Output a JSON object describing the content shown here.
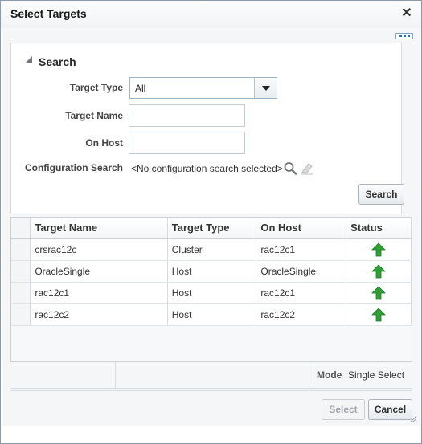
{
  "dialog": {
    "title": "Select Targets",
    "close_symbol": "✕"
  },
  "search": {
    "header": "Search",
    "target_type_label": "Target Type",
    "target_type_value": "All",
    "target_name_label": "Target Name",
    "target_name_value": "",
    "on_host_label": "On Host",
    "on_host_value": "",
    "config_search_label": "Configuration Search",
    "config_search_value": "<No configuration search selected>",
    "search_button": "Search"
  },
  "table": {
    "columns": [
      "Target Name",
      "Target Type",
      "On Host",
      "Status"
    ],
    "rows": [
      {
        "target_name": "crsrac12c",
        "target_type": "Cluster",
        "on_host": "rac12c1",
        "status": "up"
      },
      {
        "target_name": "OracleSingle",
        "target_type": "Host",
        "on_host": "OracleSingle",
        "status": "up"
      },
      {
        "target_name": "rac12c1",
        "target_type": "Host",
        "on_host": "rac12c1",
        "status": "up"
      },
      {
        "target_name": "rac12c2",
        "target_type": "Host",
        "on_host": "rac12c2",
        "status": "up"
      }
    ]
  },
  "footer": {
    "mode_label": "Mode",
    "mode_value": "Single Select",
    "select_button": "Select",
    "cancel_button": "Cancel"
  },
  "colors": {
    "status_up": "#2f9e35",
    "accent_border": "#9bb3c8"
  }
}
